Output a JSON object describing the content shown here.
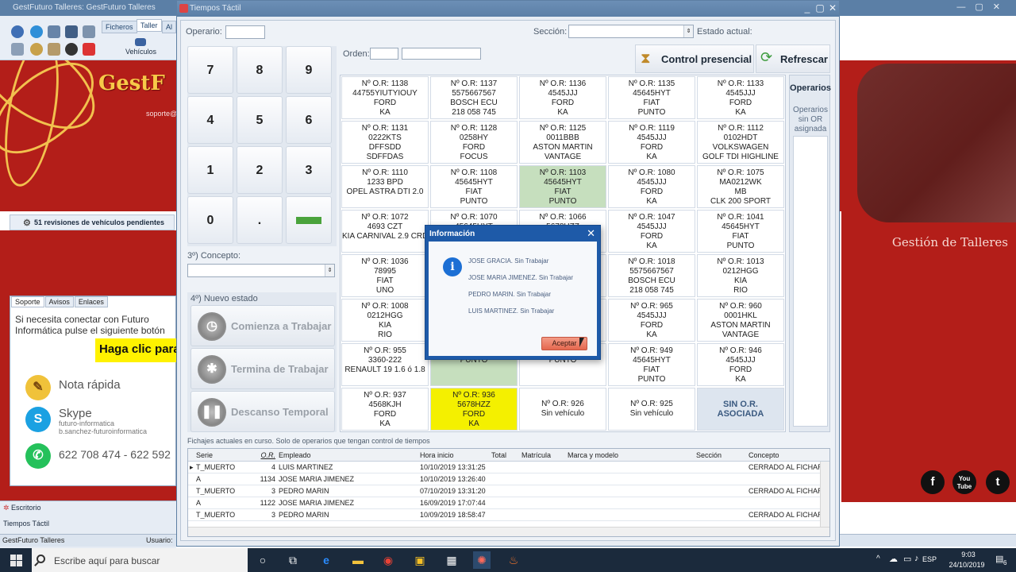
{
  "background_app": {
    "title": "GestFuturo Talleres: GestFuturo Talleres",
    "ribbon_tabs": [
      "Ficheros",
      "Taller",
      "Al"
    ],
    "vehiculos_label": "Vehículos",
    "logo_text": "GestF",
    "support_email": "soporte@",
    "pending_revisions": "51 revisiones de vehículos pendientes",
    "support_tabs": [
      "Soporte",
      "Avisos",
      "Enlaces"
    ],
    "support_text": "Si necesita conectar con Futuro Informática pulse el siguiente botón",
    "haga_clic": "Haga clic para",
    "nota_rapida": "Nota rápida",
    "skype_label": "Skype",
    "skype_user1": "futuro-informatica",
    "skype_user2": "b.sanchez-futuroinformatica",
    "whatsapp": "622 708 474 - 622 592",
    "gestion_talleres": "Gestión de Talleres",
    "escritorio": "Escritorio",
    "tiempos_tactil_item": "Tiempos Táctil",
    "footer_app": "GestFuturo Talleres",
    "footer_usuario": "Usuario:",
    "social": {
      "facebook": "f",
      "youtube": "You Tube",
      "twitter": "t"
    }
  },
  "window": {
    "title": "Tiempos Táctil",
    "operario_label": "Operario:",
    "seccion_label": "Sección:",
    "estado_actual_label": "Estado actual:",
    "orden_label": "Orden:",
    "control_presencial": "Control presencial",
    "refrescar": "Refrescar",
    "keypad": [
      "7",
      "8",
      "9",
      "4",
      "5",
      "6",
      "1",
      "2",
      "3",
      "0",
      "."
    ],
    "concepto_label": "3º) Concepto:",
    "nuevo_estado_label": "4º) Nuevo estado",
    "btn_comienza": "Comienza a Trabajar",
    "btn_termina": "Termina de Trabajar",
    "btn_descanso": "Descanso Temporal",
    "operarios_title": "Operarios",
    "operarios_sub": "Operarios sin OR asignada"
  },
  "orders": [
    [
      "Nº O.R: 1138",
      "44755YIUTYIOUY",
      "FORD",
      "KA"
    ],
    [
      "Nº O.R: 1137",
      "5575667567",
      "BOSCH ECU",
      "218 058 745"
    ],
    [
      "Nº O.R: 1136",
      "4545JJJ",
      "FORD",
      "KA"
    ],
    [
      "Nº O.R: 1135",
      "45645HYT",
      "FIAT",
      "PUNTO"
    ],
    [
      "Nº O.R: 1133",
      "4545JJJ",
      "FORD",
      "KA"
    ],
    [
      "Nº O.R: 1131",
      "0222KTS",
      "DFFSDD",
      "SDFFDAS"
    ],
    [
      "Nº O.R: 1128",
      "0258HY",
      "FORD",
      "FOCUS"
    ],
    [
      "Nº O.R: 1125",
      "0011BBB",
      "ASTON MARTIN",
      "VANTAGE"
    ],
    [
      "Nº O.R: 1119",
      "4545JJJ",
      "FORD",
      "KA"
    ],
    [
      "Nº O.R: 1112",
      "0102HDT",
      "VOLKSWAGEN",
      "GOLF TDI HIGHLINE"
    ],
    [
      "Nº O.R: 1110",
      "1233 BPD",
      "OPEL ASTRA DTI 2.0",
      ""
    ],
    [
      "Nº O.R: 1108",
      "45645HYT",
      "FIAT",
      "PUNTO"
    ],
    [
      "Nº O.R: 1103",
      "45645HYT",
      "FIAT",
      "PUNTO"
    ],
    [
      "Nº O.R: 1080",
      "4545JJJ",
      "FORD",
      "KA"
    ],
    [
      "Nº O.R: 1075",
      "MA0212WK",
      "MB",
      "CLK 200 SPORT"
    ],
    [
      "Nº O.R: 1072",
      "4693 CZT",
      "KIA CARNIVAL 2.9 CRDI I",
      ""
    ],
    [
      "Nº O.R: 1070",
      "45645HYT",
      "",
      ""
    ],
    [
      "Nº O.R: 1066",
      "5678HZZ",
      "",
      ""
    ],
    [
      "Nº O.R: 1047",
      "4545JJJ",
      "FORD",
      "KA"
    ],
    [
      "Nº O.R: 1041",
      "45645HYT",
      "FIAT",
      "PUNTO"
    ],
    [
      "Nº O.R: 1036",
      "78995",
      "FIAT",
      "UNO"
    ],
    [
      "",
      "",
      "",
      ""
    ],
    [
      "",
      "",
      "",
      ""
    ],
    [
      "Nº O.R: 1018",
      "5575667567",
      "BOSCH ECU",
      "218 058 745"
    ],
    [
      "Nº O.R: 1013",
      "0212HGG",
      "KIA",
      "RIO"
    ],
    [
      "Nº O.R: 1008",
      "0212HGG",
      "KIA",
      "RIO"
    ],
    [
      "",
      "",
      "",
      ""
    ],
    [
      "",
      "",
      "",
      ""
    ],
    [
      "Nº O.R: 965",
      "4545JJJ",
      "FORD",
      "KA"
    ],
    [
      "Nº O.R: 960",
      "0001HKL",
      "ASTON MARTIN",
      "VANTAGE"
    ],
    [
      "Nº O.R: 955",
      "3360-222",
      "RENAULT 19 1.6 ó 1.8",
      ""
    ],
    [
      "",
      "",
      "FIAT",
      "PUNTO"
    ],
    [
      "",
      "",
      "FIAT",
      "PUNTO"
    ],
    [
      "Nº O.R: 949",
      "45645HYT",
      "FIAT",
      "PUNTO"
    ],
    [
      "Nº O.R: 946",
      "4545JJJ",
      "FORD",
      "KA"
    ],
    [
      "Nº O.R: 937",
      "4568KJH",
      "FORD",
      "KA"
    ],
    [
      "Nº O.R: 936",
      "5678HZZ",
      "FORD",
      "KA"
    ],
    [
      "Nº O.R: 926",
      "Sin vehículo",
      "",
      ""
    ],
    [
      "Nº O.R: 925",
      "Sin vehículo",
      "",
      ""
    ],
    [
      "SIN O.R.",
      "ASOCIADA",
      "",
      ""
    ]
  ],
  "order_styles": [
    "",
    "",
    "",
    "",
    "",
    "",
    "",
    "",
    "",
    "",
    "",
    "",
    "green",
    "",
    "",
    "",
    "",
    "",
    "",
    "",
    "",
    "",
    "",
    "",
    "",
    "",
    "",
    "",
    "",
    "",
    "",
    "green",
    "",
    "",
    "",
    "",
    "yellow",
    "none",
    "none",
    "sinor"
  ],
  "fichajes": {
    "caption": "Fichajes actuales en curso. Solo de operarios que tengan control de tiempos",
    "columns": [
      "Serie",
      "O.R.",
      "Empleado",
      "Hora inicio",
      "Total",
      "Matrícula",
      "Marca y modelo",
      "Sección",
      "Concepto"
    ],
    "rows": [
      [
        "T_MUERTO",
        "4",
        "LUIS MARTINEZ",
        "10/10/2019 13:31:25",
        "",
        "",
        "",
        "",
        "CERRADO AL FICHAR"
      ],
      [
        "A",
        "1134",
        "JOSE MARIA JIMENEZ",
        "10/10/2019 13:26:40",
        "",
        "",
        "",
        "",
        ""
      ],
      [
        "T_MUERTO",
        "3",
        "PEDRO MARIN",
        "07/10/2019 13:31:20",
        "",
        "",
        "",
        "",
        "CERRADO AL FICHAR"
      ],
      [
        "A",
        "1122",
        "JOSE MARIA JIMENEZ",
        "16/09/2019 17:07:44",
        "",
        "",
        "",
        "",
        ""
      ],
      [
        "T_MUERTO",
        "3",
        "PEDRO MARIN",
        "10/09/2019 18:58:47",
        "",
        "",
        "",
        "",
        "CERRADO AL FICHAR"
      ]
    ]
  },
  "dialog": {
    "title": "Información",
    "lines": [
      "JOSE GRACIA. Sin Trabajar",
      "JOSE MARIA JIMENEZ. Sin Trabajar",
      "PEDRO MARIN. Sin Trabajar",
      "LUIS MARTINEZ. Sin Trabajar"
    ],
    "ok_label": "Aceptar"
  },
  "taskbar": {
    "search_placeholder": "Escribe aquí para buscar",
    "language": "ESP",
    "time": "9:03",
    "date": "24/10/2019",
    "notification_count": "6"
  }
}
